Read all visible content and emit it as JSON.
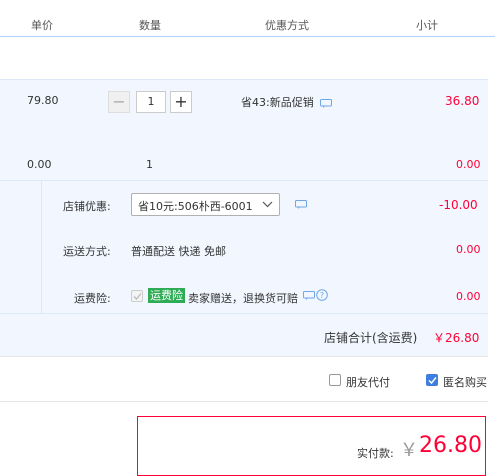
{
  "header": {
    "col_price": "单价",
    "col_qty": "数量",
    "col_promo": "优惠方式",
    "col_subtotal": "小计"
  },
  "item1": {
    "price": "79.80",
    "quantity": "1",
    "promo": "省43:新品促销",
    "subtotal": "36.80"
  },
  "item2": {
    "price": "0.00",
    "quantity": "1",
    "subtotal": "0.00"
  },
  "shop": {
    "discount_label": "店铺优惠:",
    "discount_selected": "省10元:506朴西-6001",
    "discount_amount": "-10.00",
    "shipping_label": "运送方式:",
    "shipping_value": "普通配送 快递 免邮",
    "shipping_amount": "0.00",
    "insurance_label": "运费险:",
    "insurance_badge": "运费险",
    "insurance_text": "卖家赠送，退换货可赔",
    "insurance_amount": "0.00",
    "total_label": "店铺合计(含运费)",
    "total_value": "￥26.80"
  },
  "options": {
    "friend_pay": "朋友代付",
    "anonymous": "匿名购买"
  },
  "payment": {
    "label": "实付款:",
    "currency": "￥",
    "amount": "26.80"
  },
  "colors": {
    "accent_red": "#ff0036",
    "light_blue_bg": "#f2f7ff",
    "checkbox_blue": "#3d7ede",
    "badge_green": "#2eac55"
  }
}
